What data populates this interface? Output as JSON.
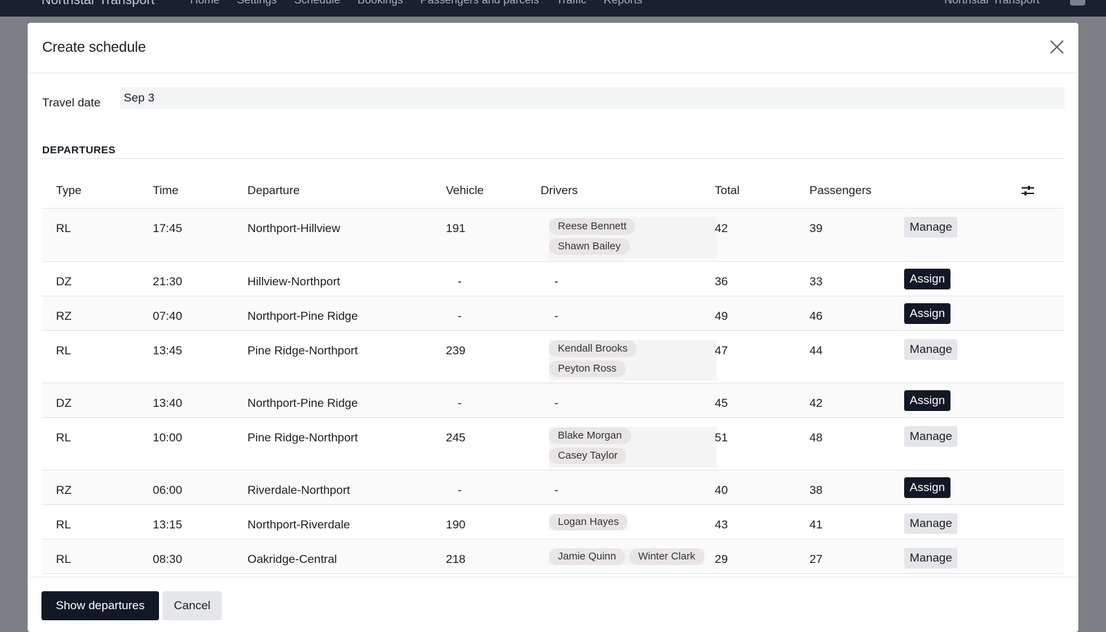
{
  "topbar": {
    "brand": "Northstar Transport",
    "nav": [
      "Home",
      "Settings",
      "Schedule",
      "Bookings",
      "Passengers and parcels",
      "Traffic",
      "Reports"
    ],
    "org": "Northstar Transport"
  },
  "dialog": {
    "title": "Create schedule",
    "travel_date_label": "Travel date",
    "travel_date_value": "Sep 3",
    "section_title": "DEPARTURES"
  },
  "table": {
    "columns": [
      "Type",
      "Time",
      "Departure",
      "Vehicle",
      "Drivers",
      "Total",
      "Passengers"
    ],
    "rows": [
      {
        "type": "RL",
        "time": "17:45",
        "departure": "Northport-Hillview",
        "vehicle": "191",
        "drivers": [
          "Reese Bennett",
          "Shawn Bailey"
        ],
        "total": "42",
        "passengers": "39",
        "action": "Manage"
      },
      {
        "type": "DZ",
        "time": "21:30",
        "departure": "Hillview-Northport",
        "vehicle": "-",
        "drivers_text": "-",
        "total": "36",
        "passengers": "33",
        "action": "Assign"
      },
      {
        "type": "RZ",
        "time": "07:40",
        "departure": "Northport-Pine Ridge",
        "vehicle": "-",
        "drivers_text": "-",
        "total": "49",
        "passengers": "46",
        "action": "Assign"
      },
      {
        "type": "RL",
        "time": "13:45",
        "departure": "Pine Ridge-Northport",
        "vehicle": "239",
        "drivers": [
          "Kendall Brooks",
          "Peyton Ross"
        ],
        "total": "47",
        "passengers": "44",
        "action": "Manage"
      },
      {
        "type": "DZ",
        "time": "13:40",
        "departure": "Northport-Pine Ridge",
        "vehicle": "-",
        "drivers_text": "-",
        "total": "45",
        "passengers": "42",
        "action": "Assign"
      },
      {
        "type": "RL",
        "time": "10:00",
        "departure": "Pine Ridge-Northport",
        "vehicle": "245",
        "drivers": [
          "Blake Morgan",
          "Casey Taylor"
        ],
        "total": "51",
        "passengers": "48",
        "action": "Manage"
      },
      {
        "type": "RZ",
        "time": "06:00",
        "departure": "Riverdale-Northport",
        "vehicle": "-",
        "drivers_text": "-",
        "total": "40",
        "passengers": "38",
        "action": "Assign"
      },
      {
        "type": "RL",
        "time": "13:15",
        "departure": "Northport-Riverdale",
        "vehicle": "190",
        "drivers": [
          "Logan Hayes"
        ],
        "total": "43",
        "passengers": "41",
        "action": "Manage"
      },
      {
        "type": "RL",
        "time": "08:30",
        "departure": "Oakridge-Central",
        "vehicle": "218",
        "drivers": [
          "Jamie Quinn",
          "Winter Clark"
        ],
        "total": "29",
        "passengers": "27",
        "action": "Manage"
      }
    ]
  },
  "footer": {
    "primary_label": "Show departures",
    "cancel_label": "Cancel"
  },
  "icons": {
    "close": "close-icon",
    "columns": "sliders-icon",
    "apps": "grid-icon",
    "user": "user-icon"
  },
  "colors": {
    "primary": "#121826",
    "secondary": "#e4e6ea",
    "chip": "#e9e5e4",
    "overlay": "#7c7f85"
  }
}
